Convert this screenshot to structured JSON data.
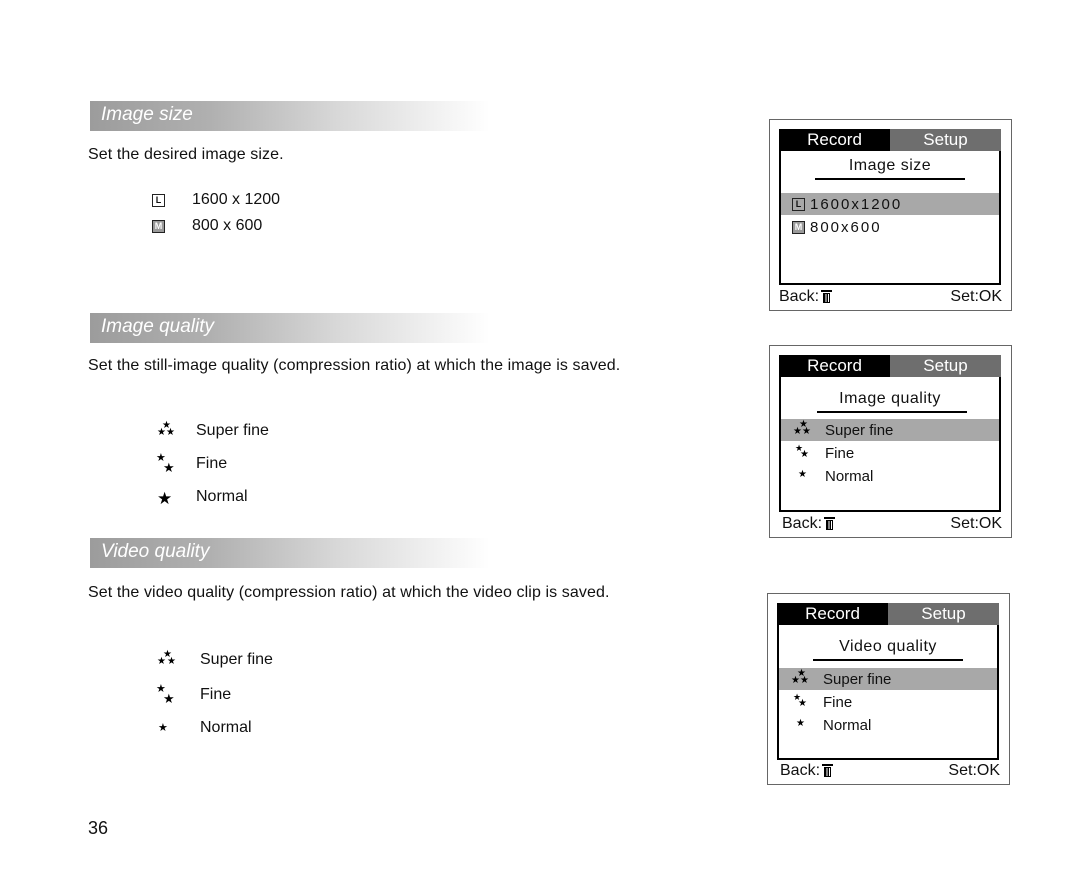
{
  "page_number": "36",
  "sections": [
    {
      "heading": "Image size",
      "description": "Set the desired image size.",
      "options": [
        {
          "icon": "size-large-icon",
          "glyph": "L",
          "label": "1600 x 1200"
        },
        {
          "icon": "size-medium-icon",
          "glyph": "M",
          "label": "800 x 600"
        }
      ],
      "lcd": {
        "tabs": [
          "Record",
          "Setup"
        ],
        "title": "Image size",
        "items": [
          {
            "icon": "size-large-icon",
            "glyph": "L",
            "label": "1600x1200",
            "selected": true
          },
          {
            "icon": "size-medium-icon",
            "glyph": "M",
            "label": "800x600",
            "selected": false
          }
        ],
        "back_label": "Back:",
        "back_icon": "trash-icon",
        "set_label": "Set:OK"
      }
    },
    {
      "heading": "Image quality",
      "description": "Set the still-image quality (compression ratio) at which the image is saved.",
      "options": [
        {
          "icon": "three-stars-icon",
          "label": "Super fine"
        },
        {
          "icon": "two-stars-icon",
          "label": "Fine"
        },
        {
          "icon": "one-star-icon",
          "label": "Normal"
        }
      ],
      "lcd": {
        "tabs": [
          "Record",
          "Setup"
        ],
        "title": "Image quality",
        "items": [
          {
            "icon": "three-stars-icon",
            "label": "Super fine",
            "selected": true
          },
          {
            "icon": "two-stars-icon",
            "label": "Fine",
            "selected": false
          },
          {
            "icon": "one-star-icon",
            "label": "Normal",
            "selected": false
          }
        ],
        "back_label": "Back:",
        "back_icon": "trash-icon",
        "set_label": "Set:OK"
      }
    },
    {
      "heading": "Video quality",
      "description": "Set the video quality (compression ratio) at which the video clip is saved.",
      "options": [
        {
          "icon": "three-stars-icon",
          "label": "Super fine"
        },
        {
          "icon": "two-stars-icon",
          "label": "Fine"
        },
        {
          "icon": "one-star-icon",
          "label": "Normal"
        }
      ],
      "lcd": {
        "tabs": [
          "Record",
          "Setup"
        ],
        "title": "Video quality",
        "items": [
          {
            "icon": "three-stars-icon",
            "label": "Super fine",
            "selected": true
          },
          {
            "icon": "two-stars-icon",
            "label": "Fine",
            "selected": false
          },
          {
            "icon": "one-star-icon",
            "label": "Normal",
            "selected": false
          }
        ],
        "back_label": "Back:",
        "back_icon": "trash-icon",
        "set_label": "Set:OK"
      }
    }
  ]
}
